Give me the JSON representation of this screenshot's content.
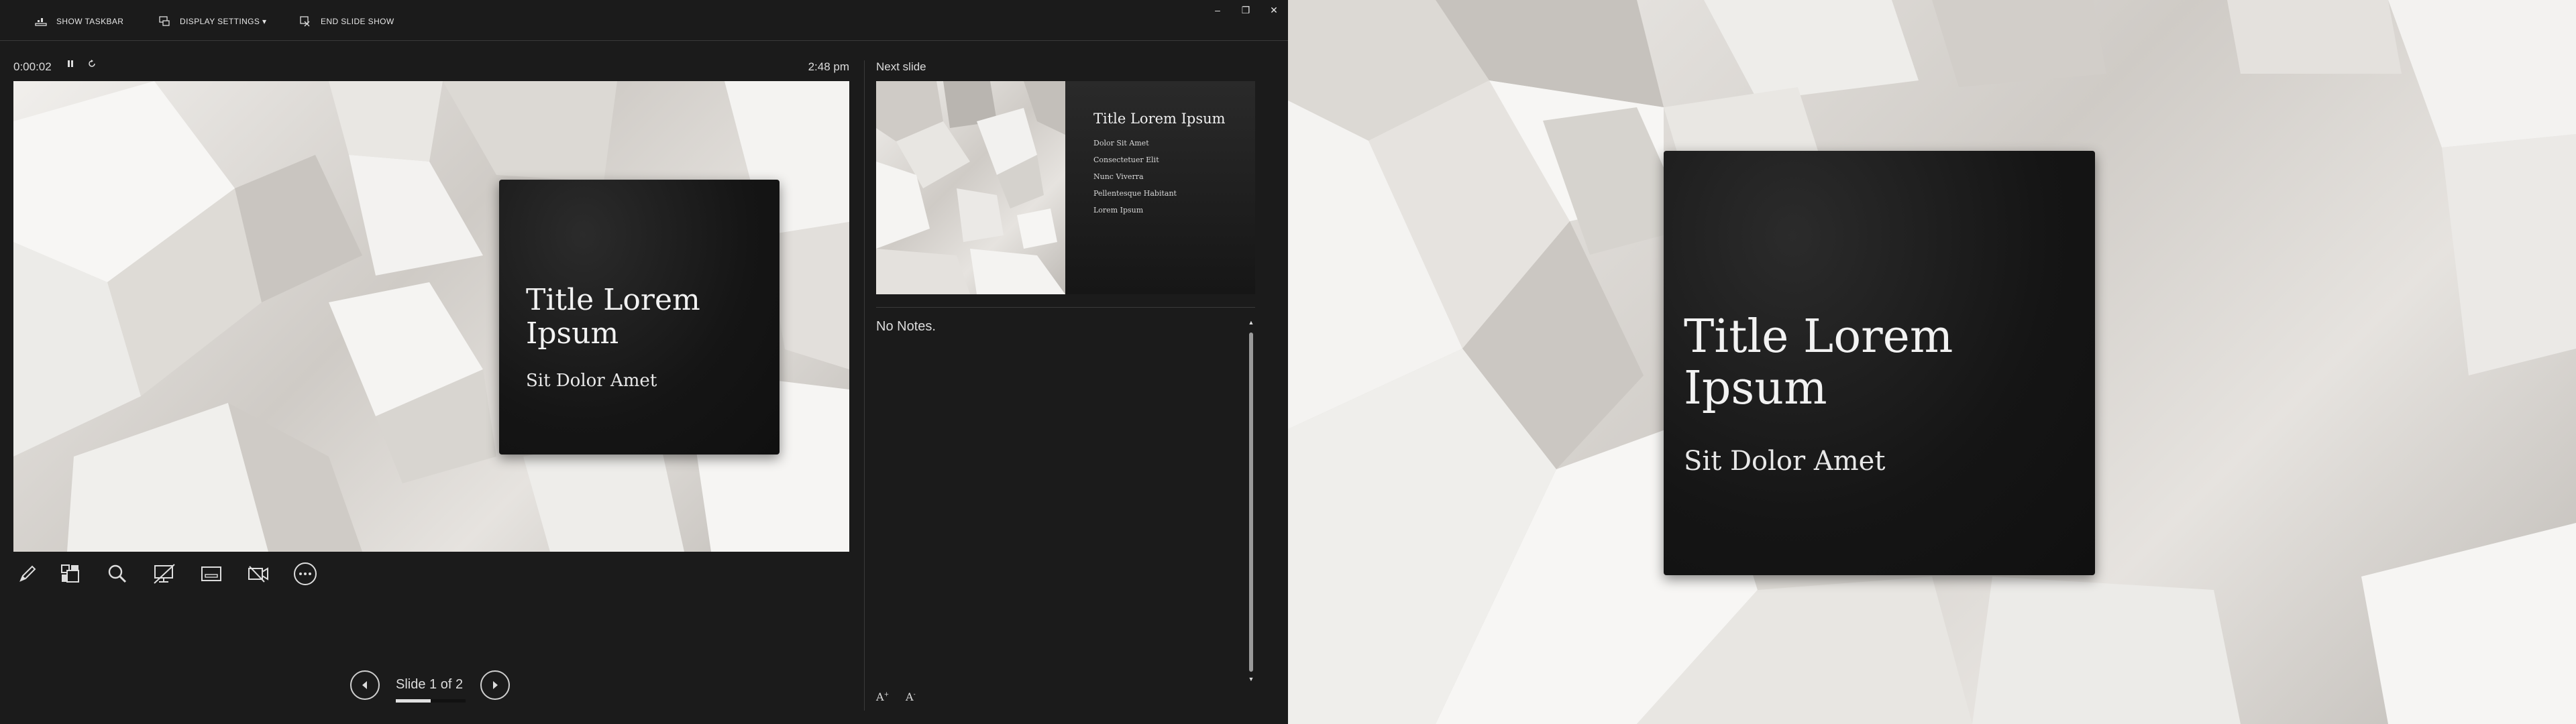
{
  "toolbar": {
    "show_taskbar": "SHOW TASKBAR",
    "display_settings": "DISPLAY SETTINGS ▾",
    "end_slide_show": "END SLIDE SHOW"
  },
  "window_controls": {
    "minimize": "–",
    "restore": "❐",
    "close": "✕"
  },
  "timer": {
    "elapsed": "0:00:02",
    "pause_icon": "pause-icon",
    "restart_icon": "restart-icon"
  },
  "clock": "2:48 pm",
  "current_slide": {
    "title_line1": "Title Lorem",
    "title_line2": "Ipsum",
    "subtitle": "Sit Dolor Amet"
  },
  "tools": [
    "pen-icon",
    "slide-grid-icon",
    "zoom-icon",
    "black-screen-icon",
    "subtitles-icon",
    "camera-off-icon",
    "more-options-icon"
  ],
  "navigation": {
    "slide_counter": "Slide 1 of 2",
    "progress": 0.5
  },
  "next_slide": {
    "label": "Next slide",
    "title": "Title Lorem Ipsum",
    "bullets": [
      "Dolor Sit Amet",
      "Consectetuer Elit",
      "Nunc Viverra",
      "Pellentesque Habitant",
      "Lorem Ipsum"
    ]
  },
  "notes": {
    "text": "No Notes."
  },
  "font_controls": {
    "increase": "A",
    "decrease": "A"
  },
  "colors": {
    "panel_bg": "#1b1b1b",
    "card_bg": "#151515",
    "text": "#e6e6e6"
  }
}
